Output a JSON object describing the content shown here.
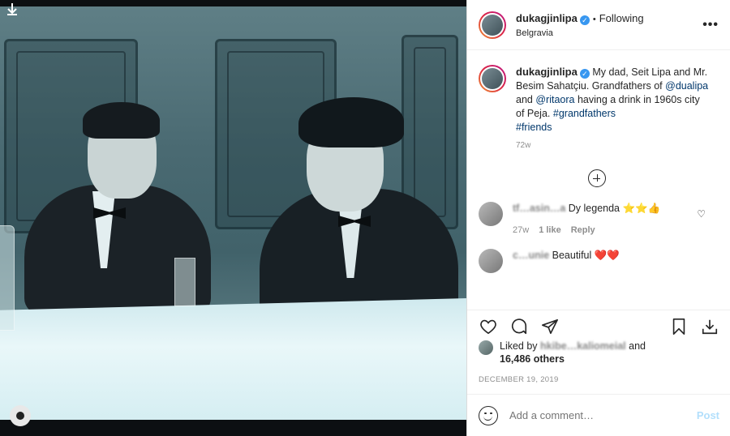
{
  "post": {
    "username": "dukagjinlipa",
    "following_label": "Following",
    "location": "Belgravia",
    "more_label": "•••",
    "caption": {
      "username": "dukagjinlipa",
      "text_before": " My dad, Seit Lipa and Mr. Besim Sahatçiu. Grandfathers of ",
      "mention1": "@dualipa",
      "text_and": " and ",
      "mention2": "@ritaora",
      "text_after": " having a drink in 1960s city of Peja. ",
      "hashtag1": "#grandfathers",
      "hashtag2": "#friends",
      "age": "72w"
    },
    "comments": [
      {
        "username": "tf…asin…a",
        "text": " Dy legenda ⭐⭐👍",
        "age": "27w",
        "likes": "1 like",
        "reply": "Reply"
      },
      {
        "username": "c…unie",
        "text": " Beautiful ❤️❤️"
      }
    ],
    "liked_by_label": "Liked by",
    "liked_by_user": "hkibe…kaliomeial",
    "and_label": "and",
    "others": "16,486 others",
    "date": "DECEMBER 19, 2019",
    "add_comment_placeholder": "Add a comment…",
    "post_label": "Post"
  },
  "icons": {
    "download": "download-arrow-icon",
    "verified": "verified-badge-icon",
    "heart": "heart-icon",
    "comment": "comment-bubble-icon",
    "share": "share-paper-plane-icon",
    "save": "bookmark-icon",
    "smile": "emoji-smile-icon",
    "plus": "plus-circle-icon"
  },
  "colors": {
    "link": "#00376b",
    "verified": "#3897f0",
    "post_disabled": "#b2dffc"
  }
}
